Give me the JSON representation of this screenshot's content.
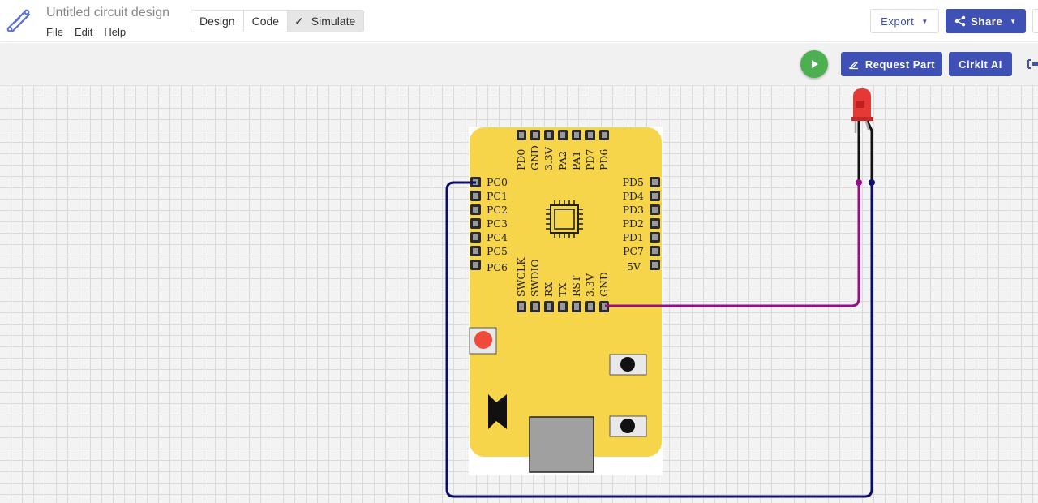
{
  "header": {
    "title": "Untitled circuit design",
    "menu": [
      "File",
      "Edit",
      "Help"
    ],
    "tabs": [
      {
        "label": "Design"
      },
      {
        "label": "Code"
      },
      {
        "label": "Simulate",
        "active": true
      }
    ],
    "export_label": "Export",
    "share_label": "Share"
  },
  "toolbar": {
    "request_label": "Request Part",
    "cirkit_label": "Cirkit AI"
  },
  "board": {
    "top_pins": [
      "PD0",
      "GND",
      "3.3V",
      "PA2",
      "PA1",
      "PD7",
      "PD6"
    ],
    "left_pins": [
      "PC0",
      "PC1",
      "PC2",
      "PC3",
      "PC4",
      "PC5",
      "PC6"
    ],
    "right_pins": [
      "PD5",
      "PD4",
      "PD3",
      "PD2",
      "PD1",
      "PC7",
      "5V"
    ],
    "bottom_pins": [
      "SWCLK",
      "SWDIO",
      "RX",
      "TX",
      "RST",
      "3.3V",
      "GND"
    ]
  },
  "colors": {
    "accent": "#3f51b5",
    "run": "#4caf50",
    "board": "#f6d54a",
    "wire_anode": "#9c0a8c",
    "wire_cathode": "#0d0d6b",
    "led": "#e53935"
  }
}
